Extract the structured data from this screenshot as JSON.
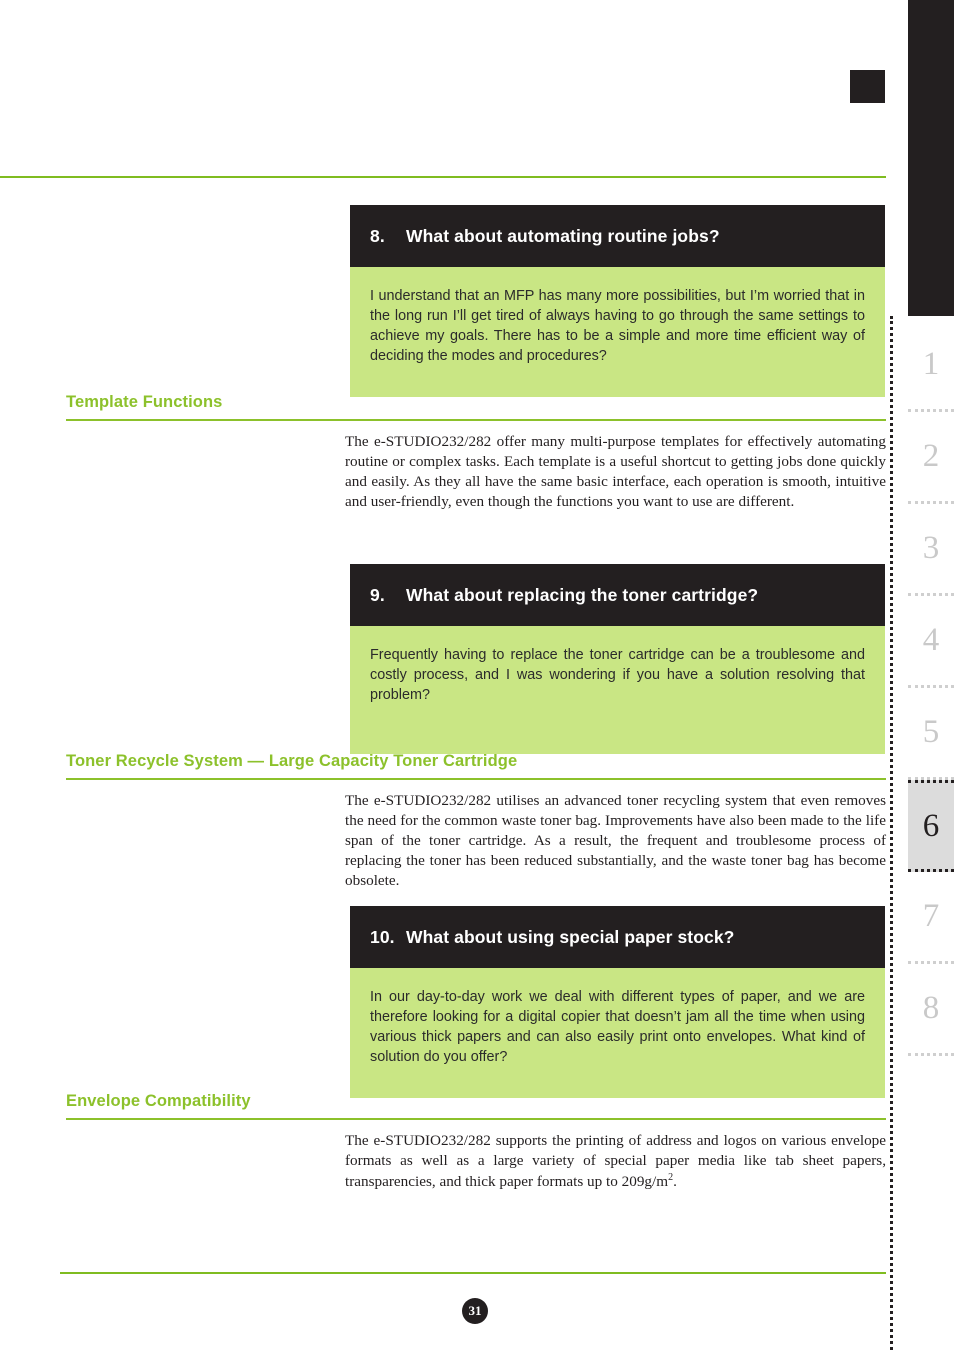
{
  "page": {
    "number": "31",
    "active_chapter": "6",
    "accent_green": "#8cc12b",
    "rule_green": "#7fbc20",
    "panel_lime": "#c9e684",
    "panel_dark": "#231f20"
  },
  "chapter_rail": {
    "tabs": [
      {
        "label": "1",
        "active": false
      },
      {
        "label": "2",
        "active": false
      },
      {
        "label": "3",
        "active": false
      },
      {
        "label": "4",
        "active": false
      },
      {
        "label": "5",
        "active": false
      },
      {
        "label": "6",
        "active": true
      },
      {
        "label": "7",
        "active": false
      },
      {
        "label": "8",
        "active": false
      }
    ]
  },
  "qa_blocks": [
    {
      "number": "8.",
      "question": "What about automating routine jobs?",
      "answer": "I understand that an MFP has many more possibilities, but I’m worried that in the long run I’ll get tired of always having to go through the same settings to achieve my goals. There has to be a simple and more time efficient way of deciding the modes and procedures?"
    },
    {
      "number": "9.",
      "question": "What about replacing the toner cartridge?",
      "answer": "Frequently having to replace the toner cartridge can be a troublesome and costly process, and I was wondering if you have a solution resolving that problem?"
    },
    {
      "number": "10.",
      "question": "What about using special paper stock?",
      "answer": "In our day-to-day work we deal with different types of paper, and we are therefore looking for a digital copier that doesn’t jam all the time when using various thick papers and can also easily print onto envelopes. What kind of solution do you offer?"
    }
  ],
  "sections": [
    {
      "title": "Template Functions",
      "paragraph": "The e-STUDIO232/282 offer many multi-purpose templates for effectively automating routine or complex tasks. Each template is a useful shortcut to getting jobs done quickly and easily. As they all have the same basic interface, each operation is smooth, intuitive and user-friendly, even though the functions you want to use are different."
    },
    {
      "title": "Toner Recycle System — Large Capacity Toner Cartridge",
      "paragraph": "The e-STUDIO232/282 utilises an advanced toner recycling system that even removes the need for the common waste toner bag. Improvements have also been made to the life span of the toner cartridge. As a result, the frequent and troublesome process of replacing the toner has been reduced substantially, and the waste toner bag has become obsolete."
    },
    {
      "title": "Envelope Compatibility",
      "paragraph_pre": "The e-STUDIO232/282 supports the printing of address and logos on various envelope formats as well as a large variety of special paper media like tab sheet papers, transparencies, and thick paper formats up to 209g/m",
      "paragraph_sup": "2",
      "paragraph_post": "."
    }
  ]
}
